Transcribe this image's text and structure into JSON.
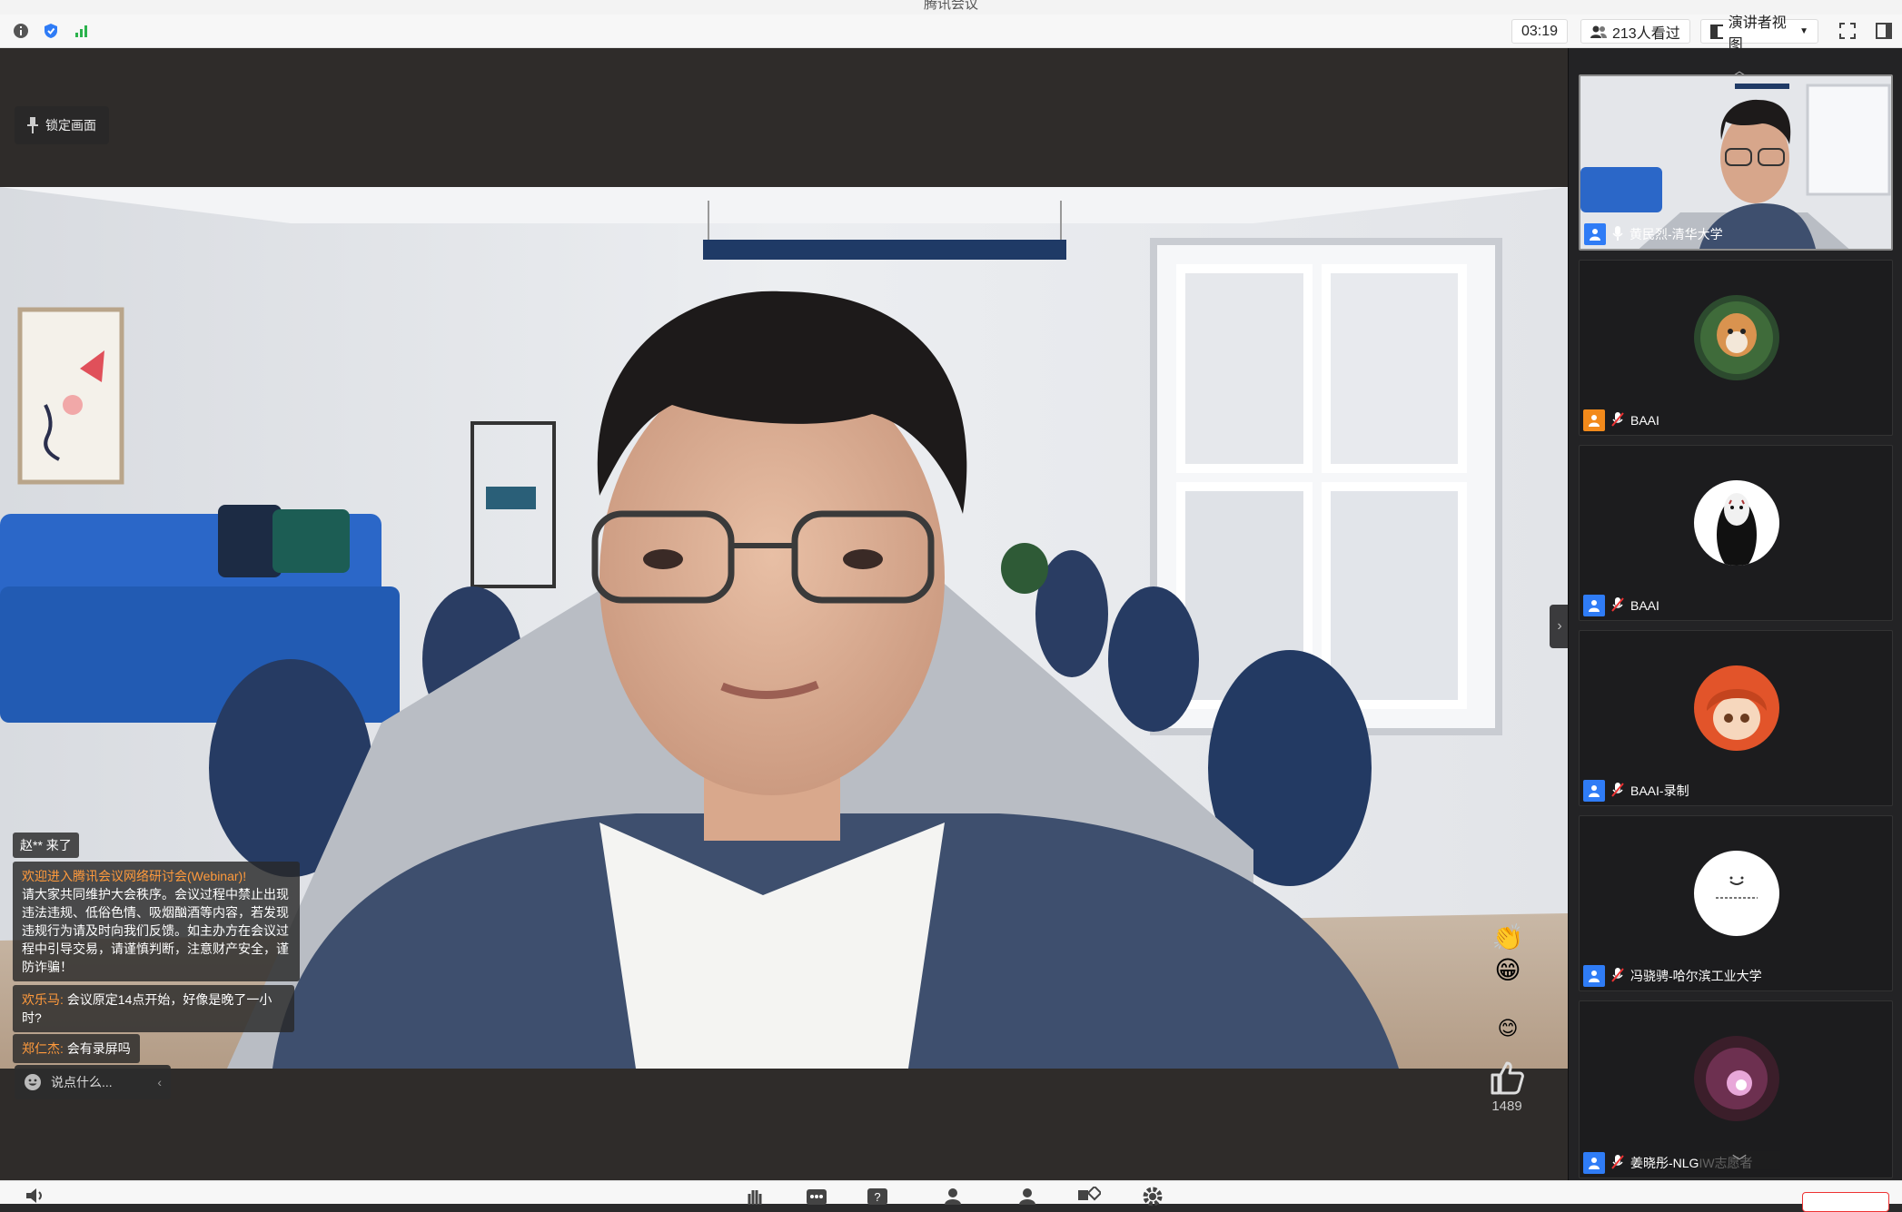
{
  "window": {
    "title": "腾讯会议"
  },
  "topbar": {
    "timer": "03:19",
    "viewers": "213人看过",
    "view_mode": "演讲者视图"
  },
  "stage": {
    "lock_label": "锁定画面",
    "chat": {
      "join_notice": "赵** 来了",
      "welcome_title": "欢迎进入腾讯会议网络研讨会(Webinar)!",
      "welcome_body": "请大家共同维护大会秩序。会议过程中禁止出现违法违规、低俗色情、吸烟酗酒等内容，若发现违规行为请及时向我们反馈。如主办方在会议过程中引导交易，请谨慎判断，注意财产安全，谨防诈骗！",
      "messages": [
        {
          "name": "欢乐马:",
          "text": "会议原定14点开始，好像是晚了一小时?"
        },
        {
          "name": "郑仁杰:",
          "text": "会有录屏吗"
        }
      ],
      "input_placeholder": "说点什么..."
    },
    "like_count": "1489"
  },
  "participants": [
    {
      "name": "黄民烈-清华大学",
      "role": "attendee",
      "mic": "on"
    },
    {
      "name": "BAAI",
      "role": "host",
      "mic": "muted"
    },
    {
      "name": "BAAI",
      "role": "attendee",
      "mic": "muted"
    },
    {
      "name": "BAAI-录制",
      "role": "attendee",
      "mic": "muted"
    },
    {
      "name": "冯骁骋-哈尔滨工业大学",
      "role": "attendee",
      "mic": "muted"
    },
    {
      "name": "姜晓彤-NLGIW志愿者",
      "role": "attendee",
      "mic": "muted"
    }
  ],
  "colors": {
    "host_badge": "#f28a1b",
    "attendee_badge": "#2f7cf6",
    "chat_name": "#ff9a3c"
  }
}
